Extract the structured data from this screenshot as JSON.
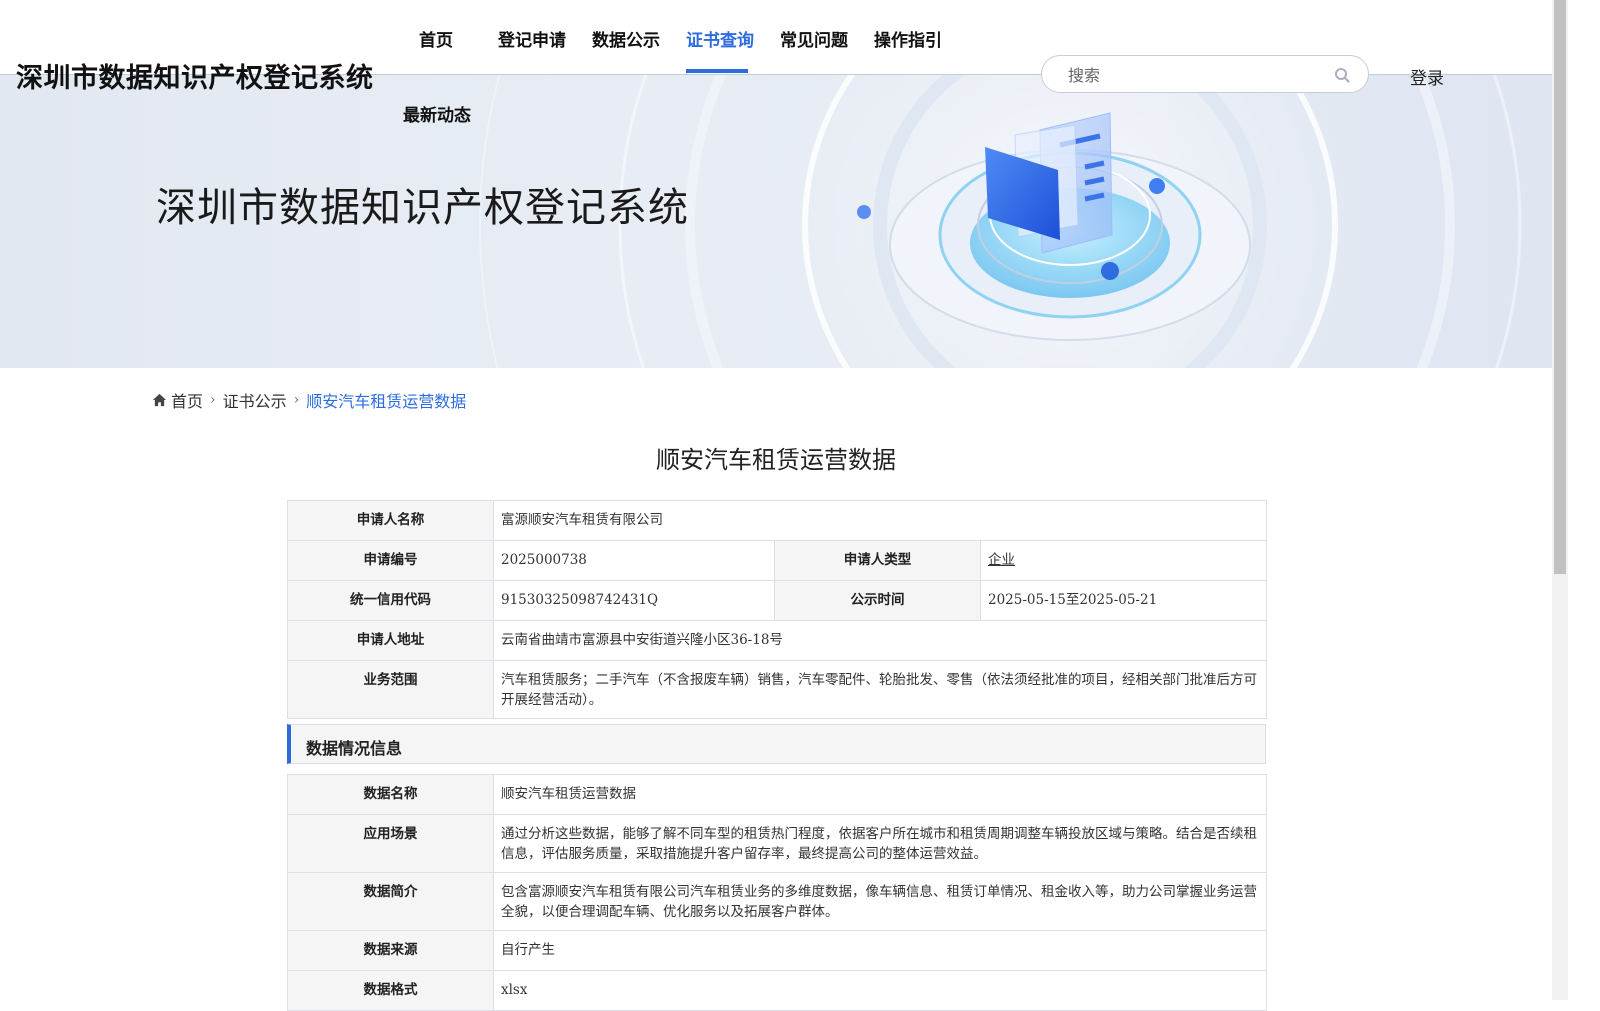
{
  "site": {
    "title": "深圳市数据知识产权登记系统"
  },
  "nav": {
    "items": [
      {
        "label": "首页"
      },
      {
        "label": "登记申请"
      },
      {
        "label": "数据公示"
      },
      {
        "label": "证书查询",
        "active": true
      },
      {
        "label": "常见问题"
      },
      {
        "label": "操作指引"
      },
      {
        "label": "最新动态"
      }
    ]
  },
  "search": {
    "placeholder": "搜索",
    "icon": "search-icon"
  },
  "login": {
    "label": "登录"
  },
  "banner": {
    "title": "深圳市数据知识产权登记系统"
  },
  "breadcrumb": {
    "home": "首页",
    "parent": "证书公示",
    "current": "顺安汽车租赁运营数据"
  },
  "page": {
    "title": "顺安汽车租赁运营数据"
  },
  "applicant": {
    "name_label": "申请人名称",
    "name": "富源顺安汽车租赁有限公司",
    "number_label": "申请编号",
    "number": "2025000738",
    "type_label": "申请人类型",
    "type": "企业",
    "credit_label": "统一信用代码",
    "credit": "91530325098742431Q",
    "publicity_label": "公示时间",
    "publicity": "2025-05-15至2025-05-21",
    "address_label": "申请人地址",
    "address": "云南省曲靖市富源县中安街道兴隆小区36-18号",
    "scope_label": "业务范围",
    "scope": "汽车租赁服务；二手汽车（不含报废车辆）销售，汽车零配件、轮胎批发、零售（依法须经批准的项目，经相关部门批准后方可开展经营活动）。"
  },
  "data_section": {
    "title": "数据情况信息",
    "name_label": "数据名称",
    "name": "顺安汽车租赁运营数据",
    "scenario_label": "应用场景",
    "scenario": "通过分析这些数据，能够了解不同车型的租赁热门程度，依据客户所在城市和租赁周期调整车辆投放区域与策略。结合是否续租信息，评估服务质量，采取措施提升客户留存率，最终提高公司的整体运营效益。",
    "intro_label": "数据简介",
    "intro": "包含富源顺安汽车租赁有限公司汽车租赁业务的多维度数据，像车辆信息、租赁订单情况、租金收入等，助力公司掌握业务运营全貌，以便合理调配车辆、优化服务以及拓展客户群体。",
    "source_label": "数据来源",
    "source": "自行产生",
    "format_label": "数据格式",
    "format": "xlsx"
  },
  "colors": {
    "accent": "#2d6cdf",
    "label_bg": "#f5f5f5",
    "border": "#dcdfe6"
  }
}
